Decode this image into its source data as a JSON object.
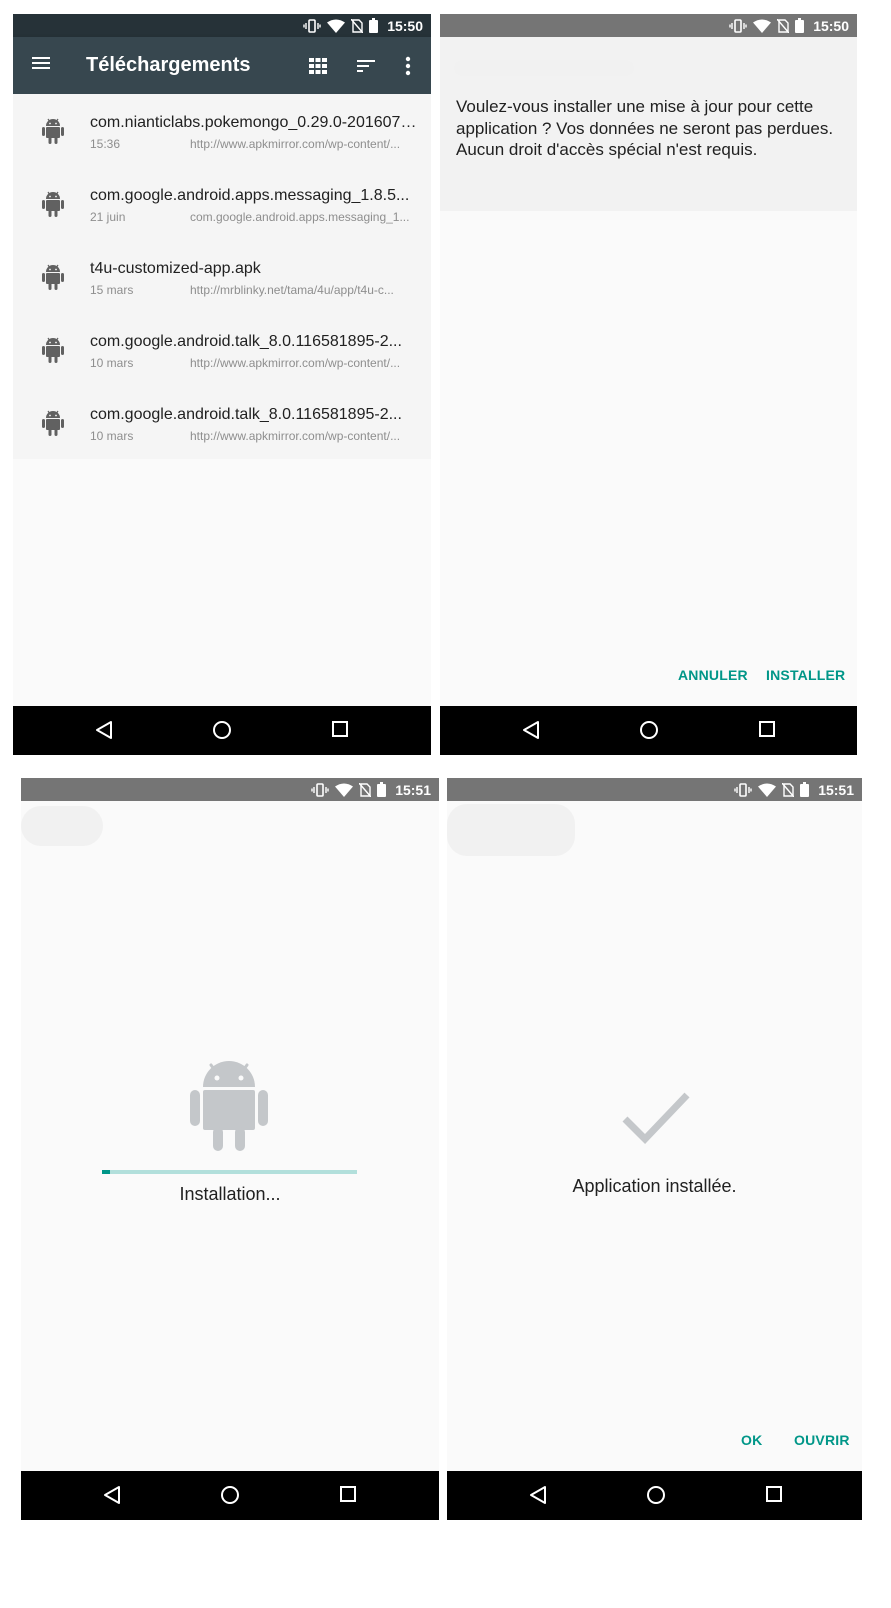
{
  "status_bar": {
    "time_1": "15:50",
    "time_2": "15:50",
    "time_3": "15:51",
    "time_4": "15:51",
    "icons": [
      "vibrate-icon",
      "wifi-icon",
      "no-sim-icon",
      "battery-icon"
    ]
  },
  "downloads": {
    "title": "Téléchargements",
    "items": [
      {
        "name": "com.nianticlabs.pokemongo_0.29.0-2016070...",
        "date": "15:36",
        "url": "http://www.apkmirror.com/wp-content/..."
      },
      {
        "name": "com.google.android.apps.messaging_1.8.5...",
        "date": "21 juin",
        "url": "com.google.android.apps.messaging_1..."
      },
      {
        "name": "t4u-customized-app.apk",
        "date": "15 mars",
        "url": "http://mrblinky.net/tama/4u/app/t4u-c..."
      },
      {
        "name": "com.google.android.talk_8.0.116581895-2...",
        "date": "10 mars",
        "url": "http://www.apkmirror.com/wp-content/..."
      },
      {
        "name": "com.google.android.talk_8.0.116581895-2...",
        "date": "10 mars",
        "url": "http://www.apkmirror.com/wp-content/..."
      }
    ]
  },
  "install_prompt": {
    "message": "Voulez-vous installer une mise à jour pour cette application ? Vos données ne seront pas perdues. Aucun droit d'accès spécial n'est requis.",
    "cancel_label": "ANNULER",
    "install_label": "INSTALLER"
  },
  "installing": {
    "message": "Installation...",
    "progress_percent": 3
  },
  "installed": {
    "message": "Application installée.",
    "ok_label": "OK",
    "open_label": "OUVRIR"
  },
  "colors": {
    "app_bar": "#37474f",
    "status_bar_dark": "#263238",
    "status_bar_grey": "#757575",
    "accent": "#009688",
    "icon_grey": "#616161"
  }
}
